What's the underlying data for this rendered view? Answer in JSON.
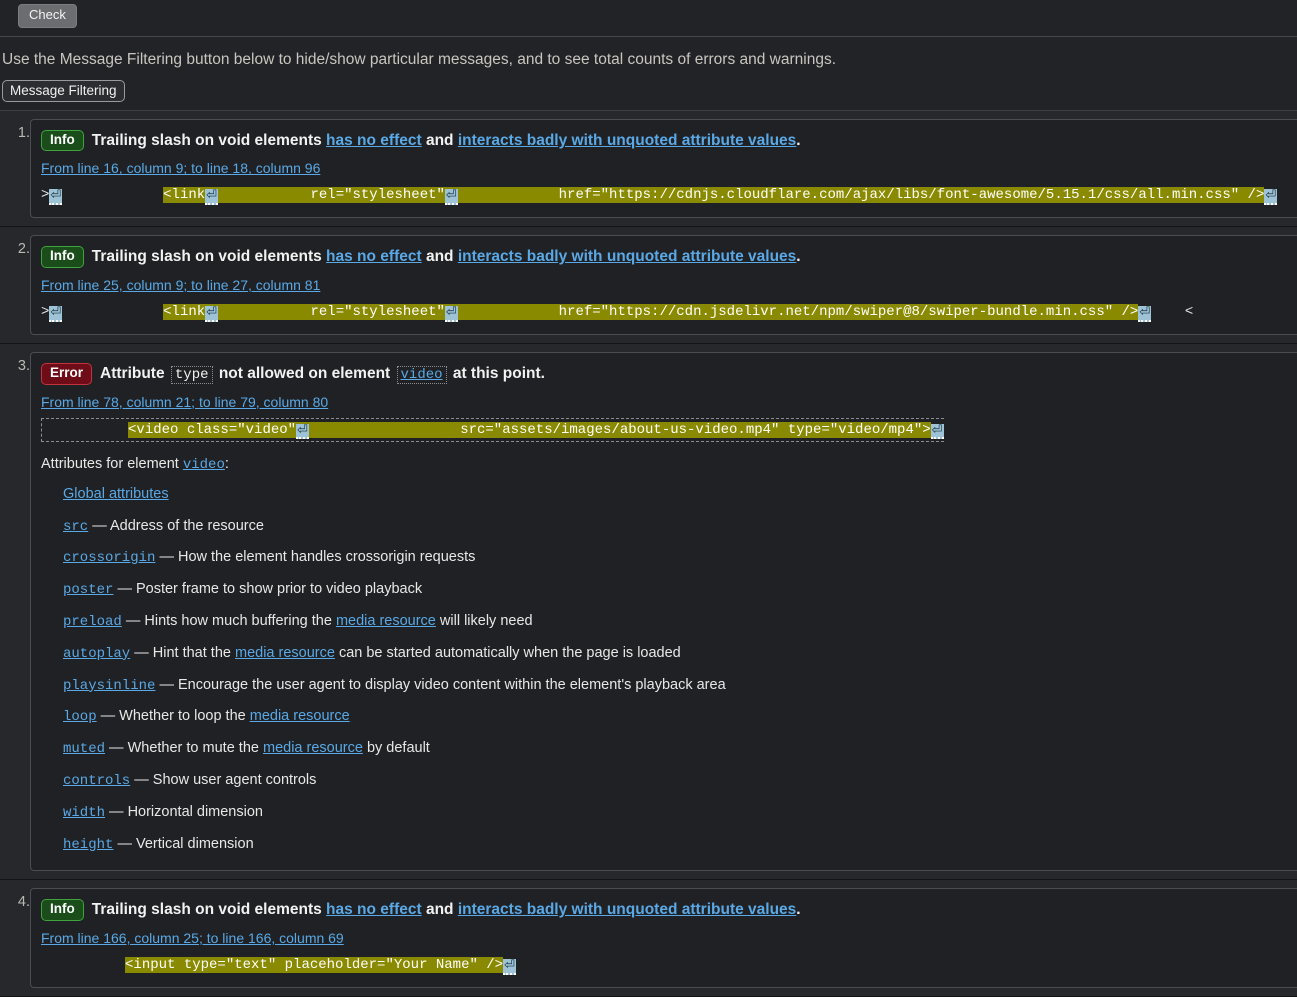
{
  "toolbar": {
    "check_label": "Check"
  },
  "filtering": {
    "note": "Use the Message Filtering button below to hide/show particular messages, and to see total counts of errors and warnings.",
    "button_label": "Message Filtering"
  },
  "messages": [
    {
      "number": "1.",
      "badge": "Info",
      "badge_type": "info",
      "headline_parts": [
        {
          "type": "text",
          "text": "Trailing slash on void elements "
        },
        {
          "type": "link",
          "text": "has no effect"
        },
        {
          "type": "text",
          "text": " and "
        },
        {
          "type": "link",
          "text": "interacts badly with unquoted attribute values"
        },
        {
          "type": "text",
          "text": "."
        }
      ],
      "location": "From line 16, column 9; to line 18, column 96",
      "extract": {
        "boxed": false,
        "prefix": ">",
        "pre_gap": "            ",
        "code": "<link",
        "mid_gap": "           ",
        "code2": "rel=\"stylesheet\"",
        "mid_gap2": "            ",
        "code3": "href=\"https://cdnjs.cloudflare.com/ajax/libs/font-awesome/5.15.1/css/all.min.css\" />",
        "suffix": ""
      }
    },
    {
      "number": "2.",
      "badge": "Info",
      "badge_type": "info",
      "headline_parts": [
        {
          "type": "text",
          "text": "Trailing slash on void elements "
        },
        {
          "type": "link",
          "text": "has no effect"
        },
        {
          "type": "text",
          "text": " and "
        },
        {
          "type": "link",
          "text": "interacts badly with unquoted attribute values"
        },
        {
          "type": "text",
          "text": "."
        }
      ],
      "location": "From line 25, column 9; to line 27, column 81",
      "extract": {
        "boxed": false,
        "prefix": ">",
        "pre_gap": "            ",
        "code": "<link",
        "mid_gap": "           ",
        "code2": "rel=\"stylesheet\"",
        "mid_gap2": "            ",
        "code3": "href=\"https://cdn.jsdelivr.net/npm/swiper@8/swiper-bundle.min.css\" />",
        "suffix": "    <"
      }
    },
    {
      "number": "3.",
      "badge": "Error",
      "badge_type": "error",
      "headline_parts": [
        {
          "type": "text",
          "text": "Attribute "
        },
        {
          "type": "code",
          "text": "type"
        },
        {
          "type": "text",
          "text": " not allowed on element "
        },
        {
          "type": "codelink",
          "text": "video"
        },
        {
          "type": "text",
          "text": " at this point."
        }
      ],
      "location": "From line 78, column 21; to line 79, column 80",
      "extract": {
        "boxed": true,
        "prefix": "",
        "pre_gap": "          ",
        "code": "<video class=\"video\"",
        "mid_gap": "                  ",
        "code2": "src=\"assets/images/about-us-video.mp4\" type=\"video/mp4\">",
        "mid_gap2": "",
        "code3": "",
        "suffix": ""
      },
      "attributes_doc": {
        "intro_before": "Attributes for element ",
        "intro_element": "video",
        "intro_after": ":",
        "items": [
          {
            "name": "Global attributes",
            "name_is_link": true,
            "mono": false,
            "desc_parts": []
          },
          {
            "name": "src",
            "name_is_link": true,
            "mono": true,
            "desc_parts": [
              {
                "type": "text",
                "text": " — Address of the resource"
              }
            ]
          },
          {
            "name": "crossorigin",
            "name_is_link": true,
            "mono": true,
            "desc_parts": [
              {
                "type": "text",
                "text": " — How the element handles crossorigin requests"
              }
            ]
          },
          {
            "name": "poster",
            "name_is_link": true,
            "mono": true,
            "desc_parts": [
              {
                "type": "text",
                "text": " — Poster frame to show prior to video playback"
              }
            ]
          },
          {
            "name": "preload",
            "name_is_link": true,
            "mono": true,
            "desc_parts": [
              {
                "type": "text",
                "text": " — Hints how much buffering the "
              },
              {
                "type": "link",
                "text": "media resource"
              },
              {
                "type": "text",
                "text": " will likely need"
              }
            ]
          },
          {
            "name": "autoplay",
            "name_is_link": true,
            "mono": true,
            "desc_parts": [
              {
                "type": "text",
                "text": " — Hint that the "
              },
              {
                "type": "link",
                "text": "media resource"
              },
              {
                "type": "text",
                "text": " can be started automatically when the page is loaded"
              }
            ]
          },
          {
            "name": "playsinline",
            "name_is_link": true,
            "mono": true,
            "desc_parts": [
              {
                "type": "text",
                "text": " — Encourage the user agent to display video content within the element's playback area"
              }
            ]
          },
          {
            "name": "loop",
            "name_is_link": true,
            "mono": true,
            "desc_parts": [
              {
                "type": "text",
                "text": " — Whether to loop the "
              },
              {
                "type": "link",
                "text": "media resource"
              }
            ]
          },
          {
            "name": "muted",
            "name_is_link": true,
            "mono": true,
            "desc_parts": [
              {
                "type": "text",
                "text": " — Whether to mute the "
              },
              {
                "type": "link",
                "text": "media resource"
              },
              {
                "type": "text",
                "text": " by default"
              }
            ]
          },
          {
            "name": "controls",
            "name_is_link": true,
            "mono": true,
            "desc_parts": [
              {
                "type": "text",
                "text": " — Show user agent controls"
              }
            ]
          },
          {
            "name": "width",
            "name_is_link": true,
            "mono": true,
            "desc_parts": [
              {
                "type": "text",
                "text": " — Horizontal dimension"
              }
            ]
          },
          {
            "name": "height",
            "name_is_link": true,
            "mono": true,
            "desc_parts": [
              {
                "type": "text",
                "text": " — Vertical dimension"
              }
            ]
          }
        ]
      }
    },
    {
      "number": "4.",
      "badge": "Info",
      "badge_type": "info",
      "headline_parts": [
        {
          "type": "text",
          "text": "Trailing slash on void elements "
        },
        {
          "type": "link",
          "text": "has no effect"
        },
        {
          "type": "text",
          "text": " and "
        },
        {
          "type": "link",
          "text": "interacts badly with unquoted attribute values"
        },
        {
          "type": "text",
          "text": "."
        }
      ],
      "location": "From line 166, column 25; to line 166, column 69",
      "extract": {
        "boxed": false,
        "prefix": "",
        "pre_gap": "          ",
        "code": "<input type=\"text\" placeholder=\"Your Name\" />",
        "mid_gap": "",
        "code2": "",
        "mid_gap2": "",
        "code3": "",
        "suffix": ""
      }
    }
  ],
  "icons": {
    "carriage_return": "⏎"
  },
  "colors": {
    "page_bg": "#222326",
    "panel_bg": "#26282b",
    "message_bg": "#1f2124",
    "link": "#5aa9e6",
    "highlight_bg": "#8a8a00",
    "info_badge_bg": "#1a4d1a",
    "info_badge_border": "#3fa33f",
    "error_badge_bg": "#6e0d17",
    "error_badge_border": "#c0333f"
  }
}
